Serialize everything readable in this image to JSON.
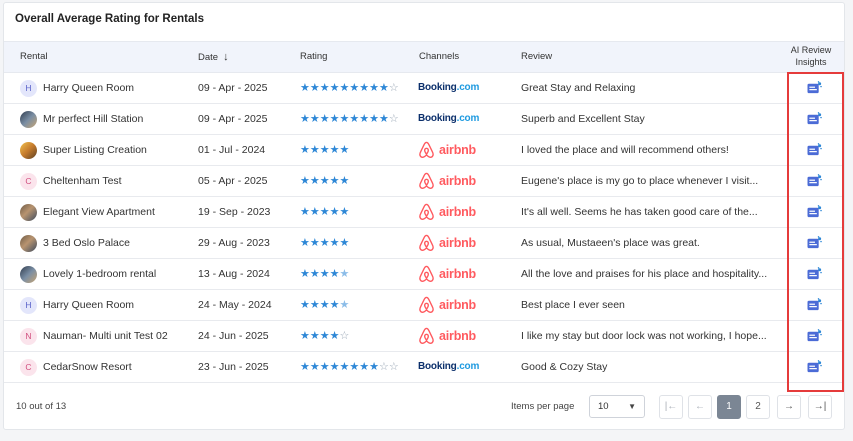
{
  "card": {
    "title": "Overall Average Rating for Rentals"
  },
  "columns": {
    "rental": "Rental",
    "date": "Date",
    "date_sort": "↓",
    "rating": "Rating",
    "channels": "Channels",
    "review": "Review",
    "ai_line1": "AI Review",
    "ai_line2": "Insights"
  },
  "rows": [
    {
      "rental": "Harry Queen Room",
      "avatar": "H",
      "avatar_style": "letter-blue",
      "date": "09 - Apr - 2025",
      "rating": 9,
      "rating_max": 10,
      "channel": "Booking.com",
      "review": "Great Stay and Relaxing"
    },
    {
      "rental": "Mr perfect Hill Station",
      "avatar": "",
      "avatar_style": "img2",
      "date": "09 - Apr - 2025",
      "rating": 9,
      "rating_max": 10,
      "channel": "Booking.com",
      "review": "Superb and Excellent Stay"
    },
    {
      "rental": "Super Listing Creation",
      "avatar": "",
      "avatar_style": "img3",
      "date": "01 - Jul - 2024",
      "rating": 5,
      "rating_max": 5,
      "channel": "airbnb",
      "review": "I loved the place and will recommend others!"
    },
    {
      "rental": "Cheltenham Test",
      "avatar": "C",
      "avatar_style": "letter-pink",
      "date": "05 - Apr - 2025",
      "rating": 5,
      "rating_max": 5,
      "channel": "airbnb",
      "review": "Eugene's place is my go to place whenever I visit..."
    },
    {
      "rental": "Elegant View Apartment",
      "avatar": "",
      "avatar_style": "img",
      "date": "19 - Sep - 2023",
      "rating": 5,
      "rating_max": 5,
      "channel": "airbnb",
      "review": "It's all well. Seems he has taken good care of the..."
    },
    {
      "rental": "3 Bed Oslo Palace",
      "avatar": "",
      "avatar_style": "img",
      "date": "29 - Aug - 2023",
      "rating": 5,
      "rating_max": 5,
      "channel": "airbnb",
      "review": "As usual, Mustaeen's place was great."
    },
    {
      "rental": "Lovely 1-bedroom rental",
      "avatar": "",
      "avatar_style": "img2",
      "date": "13 - Aug - 2024",
      "rating": 4.5,
      "rating_max": 5,
      "channel": "airbnb",
      "review": "All the love and praises for his place and hospitality..."
    },
    {
      "rental": "Harry Queen Room",
      "avatar": "H",
      "avatar_style": "letter-blue",
      "date": "24 - May - 2024",
      "rating": 4.5,
      "rating_max": 5,
      "channel": "airbnb",
      "review": "Best place I ever seen"
    },
    {
      "rental": "Nauman- Multi unit Test 02",
      "avatar": "N",
      "avatar_style": "letter-pink",
      "date": "24 - Jun - 2025",
      "rating": 4,
      "rating_max": 5,
      "channel": "airbnb",
      "review": "I like my stay but door lock was not working, I hope..."
    },
    {
      "rental": "CedarSnow Resort",
      "avatar": "C",
      "avatar_style": "letter-pink",
      "date": "23 - Jun - 2025",
      "rating": 8,
      "rating_max": 10,
      "channel": "Booking.com",
      "review": "Good & Cozy Stay"
    }
  ],
  "footer": {
    "count": "10 out of 13",
    "items_per_page_label": "Items per page",
    "items_per_page_value": "10",
    "pages": [
      "1",
      "2"
    ],
    "current_page": "1"
  },
  "colors": {
    "star": "#2d87d6",
    "airbnb": "#ff5a5f",
    "booking": "#0b2f6b",
    "highlight": "#e53b3b"
  }
}
